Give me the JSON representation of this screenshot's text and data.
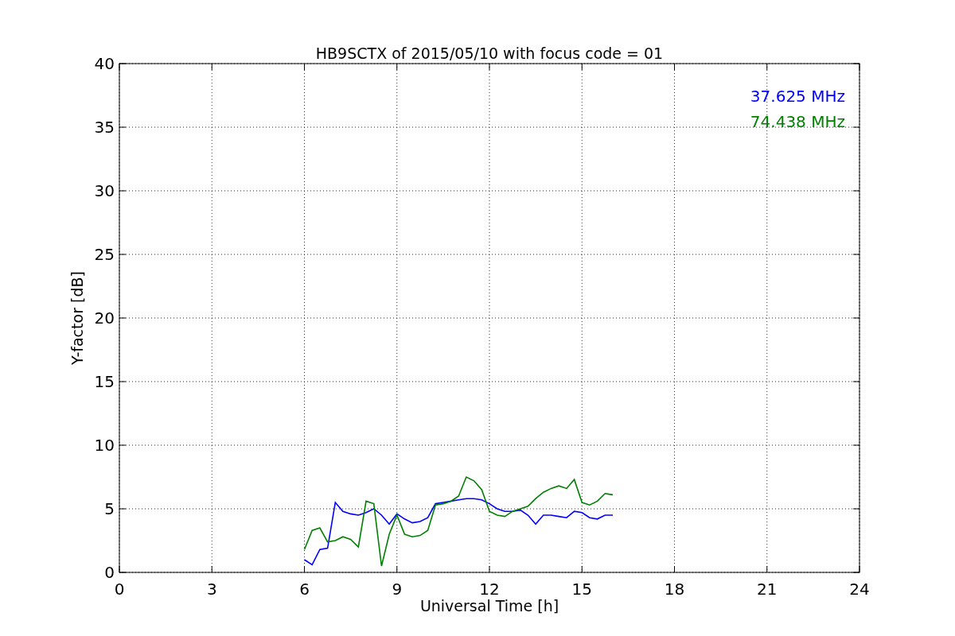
{
  "figure": {
    "chart_data": {
      "type": "line",
      "title": "HB9SCTX of 2015/05/10 with focus code = 01",
      "xlabel": "Universal Time [h]",
      "ylabel": "Y-factor [dB]",
      "x": [
        6,
        6.25,
        6.5,
        6.75,
        7,
        7.25,
        7.5,
        7.75,
        8,
        8.25,
        8.5,
        8.75,
        9,
        9.25,
        9.5,
        9.75,
        10,
        10.25,
        10.5,
        10.75,
        11,
        11.25,
        11.5,
        11.75,
        12,
        12.25,
        12.5,
        12.75,
        13,
        13.25,
        13.5,
        13.75,
        14,
        14.25,
        14.5,
        14.75,
        15,
        15.25,
        15.5,
        15.75,
        16
      ],
      "series": [
        {
          "name": "37.625 MHz",
          "color": "#0000ff",
          "values": [
            1.0,
            0.6,
            1.8,
            1.9,
            5.5,
            4.8,
            4.6,
            4.5,
            4.7,
            5.0,
            4.5,
            3.8,
            4.6,
            4.2,
            3.9,
            4.0,
            4.3,
            5.4,
            5.5,
            5.6,
            5.7,
            5.8,
            5.8,
            5.7,
            5.4,
            5.0,
            4.8,
            4.8,
            4.9,
            4.5,
            3.8,
            4.5,
            4.5,
            4.4,
            4.3,
            4.8,
            4.7,
            4.3,
            4.2,
            4.5,
            4.5
          ]
        },
        {
          "name": "74.438 MHz",
          "color": "#008000",
          "values": [
            1.8,
            3.3,
            3.5,
            2.4,
            2.5,
            2.8,
            2.6,
            2.0,
            5.6,
            5.4,
            0.5,
            3.0,
            4.5,
            3.0,
            2.8,
            2.9,
            3.3,
            5.3,
            5.4,
            5.6,
            6.0,
            7.5,
            7.2,
            6.5,
            4.8,
            4.5,
            4.4,
            4.8,
            5.0,
            5.2,
            5.8,
            6.3,
            6.6,
            6.8,
            6.6,
            7.3,
            5.5,
            5.3,
            5.6,
            6.2,
            6.1
          ]
        }
      ],
      "grid": true,
      "xlim": [
        0,
        24
      ],
      "ylim": [
        0,
        40
      ],
      "xticks": [
        0,
        3,
        6,
        9,
        12,
        15,
        18,
        21,
        24
      ],
      "yticks": [
        0,
        5,
        10,
        15,
        20,
        25,
        30,
        35,
        40
      ]
    }
  }
}
